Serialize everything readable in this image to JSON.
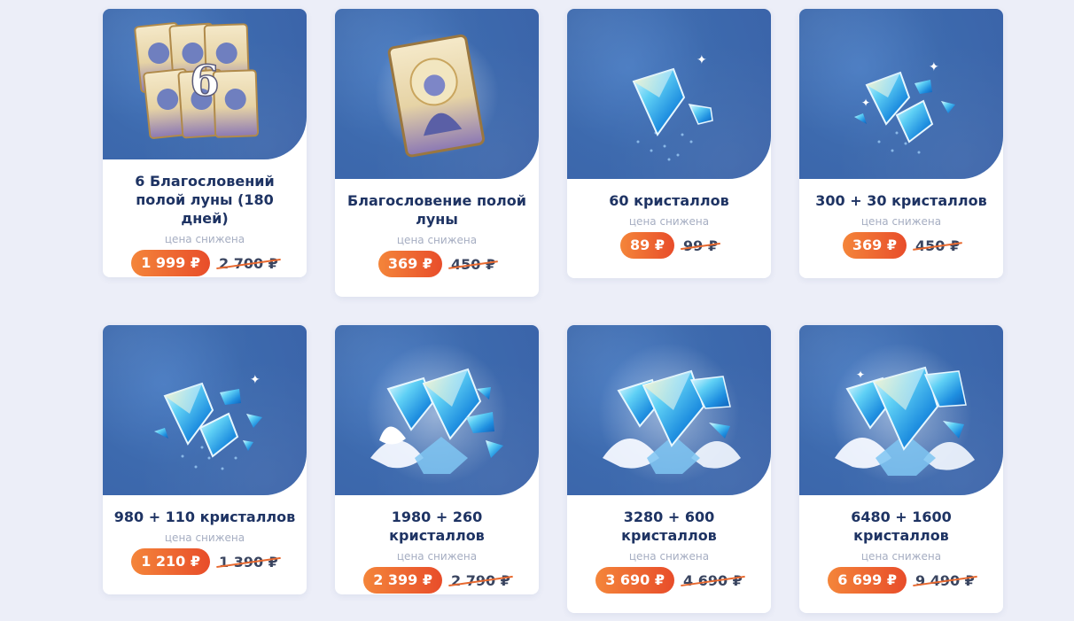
{
  "products": [
    {
      "title": "6 Благословений полой луны (180 дней)",
      "note": "цена снижена",
      "price": "1 999 ₽",
      "old_price": "2 700 ₽",
      "icon": "blessing-six-cards-icon",
      "badge": "6"
    },
    {
      "title": "Благословение полой луны",
      "note": "цена снижена",
      "price": "369 ₽",
      "old_price": "450 ₽",
      "icon": "blessing-card-icon"
    },
    {
      "title": "60 кристаллов",
      "note": "цена снижена",
      "price": "89 ₽",
      "old_price": "99 ₽",
      "icon": "crystal-icon"
    },
    {
      "title": "300 + 30 кристаллов",
      "note": "цена снижена",
      "price": "369 ₽",
      "old_price": "450 ₽",
      "icon": "crystals-icon"
    },
    {
      "title": "980 + 110 кристаллов",
      "note": "цена снижена",
      "price": "1 210 ₽",
      "old_price": "1 390 ₽",
      "icon": "crystals-icon"
    },
    {
      "title": "1980 + 260 кристаллов",
      "note": "цена снижена",
      "price": "2 399 ₽",
      "old_price": "2 790 ₽",
      "icon": "crystal-pile-icon"
    },
    {
      "title": "3280 + 600 кристаллов",
      "note": "цена снижена",
      "price": "3 690 ₽",
      "old_price": "4 690 ₽",
      "icon": "crystal-pile-icon"
    },
    {
      "title": "6480 + 1600 кристаллов",
      "note": "цена снижена",
      "price": "6 699 ₽",
      "old_price": "9 490 ₽",
      "icon": "crystal-pile-icon"
    }
  ],
  "colors": {
    "page_bg": "#eceef8",
    "card_image_bg": "#3d6aae",
    "title": "#1e3363",
    "price_gradient_start": "#f4853a",
    "price_gradient_end": "#e84d2a",
    "strike": "#e8692f"
  }
}
